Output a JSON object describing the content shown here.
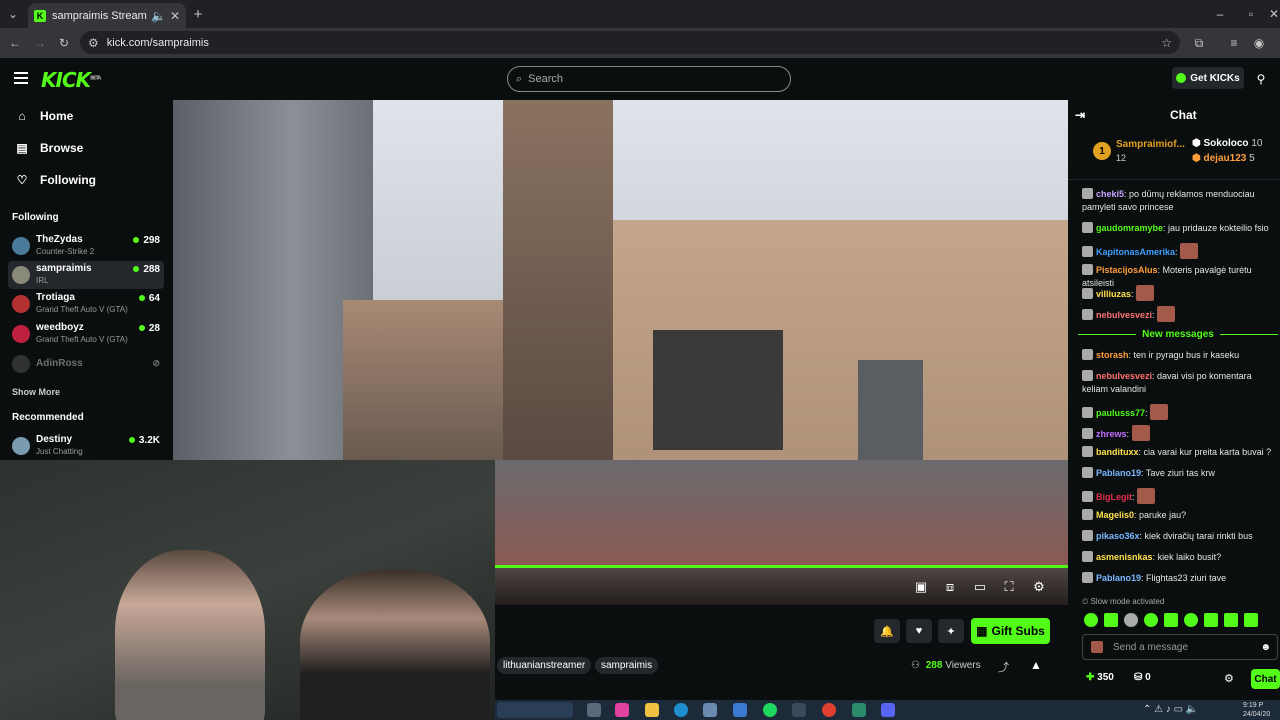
{
  "browser": {
    "tab_title": "sampraimis Stream - Watch",
    "url": "kick.com/sampraimis"
  },
  "header": {
    "logo": "KICK",
    "logo_badge": "BETA",
    "search_placeholder": "Search",
    "get_kicks_label": "Get KICKs"
  },
  "sidebar": {
    "nav": [
      {
        "label": "Home",
        "icon": "home-icon"
      },
      {
        "label": "Browse",
        "icon": "browse-icon"
      },
      {
        "label": "Following",
        "icon": "heart-icon"
      }
    ],
    "following_heading": "Following",
    "following": [
      {
        "name": "TheZydas",
        "game": "Counter-Strike 2",
        "viewers": "298"
      },
      {
        "name": "sampraimis",
        "game": "IRL",
        "viewers": "288"
      },
      {
        "name": "Trotiaga",
        "game": "Grand Theft Auto V (GTA)",
        "viewers": "64"
      },
      {
        "name": "weedboyz",
        "game": "Grand Theft Auto V (GTA)",
        "viewers": "28"
      },
      {
        "name": "AdinRoss",
        "game": "",
        "viewers": ""
      }
    ],
    "show_more": "Show More",
    "recommended_heading": "Recommended",
    "recommended": [
      {
        "name": "Destiny",
        "game": "Just Chatting",
        "viewers": "3.2K"
      }
    ]
  },
  "below_video": {
    "gift_subs_label": "Gift Subs",
    "tags": [
      "lithuanianstreamer",
      "sampraimis"
    ],
    "viewers_count": "288",
    "viewers_label": "Viewers"
  },
  "chat": {
    "title": "Chat",
    "pinned": {
      "rank": "1",
      "top_user": "Sampraimiof...",
      "top_count": "12",
      "user2": "Sokoloco",
      "user2_count": "10",
      "user3": "dejau123",
      "user3_count": "5"
    },
    "messages_before": [
      {
        "user": "cheki5",
        "color": "#c8a2ff",
        "text": "po dūmų reklamos menduociau pamyleti savo princese"
      },
      {
        "user": "gaudomramybe",
        "color": "#53fc18",
        "text": "jau pridauze kokteilio fsio"
      },
      {
        "user": "KapitonasAmerika",
        "color": "#3fa0ff",
        "text": ""
      },
      {
        "user": "PistacijosAlus",
        "color": "#ff9d3c",
        "text": "Moteris pavalgė turėtu atsileisti"
      },
      {
        "user": "villiuzas",
        "color": "#ffe14d",
        "text": ""
      },
      {
        "user": "nebulvesvezi",
        "color": "#ff7070",
        "text": ""
      }
    ],
    "new_messages_label": "New messages",
    "messages_after": [
      {
        "user": "storash",
        "color": "#ff9d3c",
        "text": "ten ir pyragu bus ir kaseku"
      },
      {
        "user": "nebulvesvezi",
        "color": "#ff7070",
        "text": "davai visi po komentara keliam valandini"
      },
      {
        "user": "paulusss77",
        "color": "#53fc18",
        "text": ""
      },
      {
        "user": "zhrews",
        "color": "#c070ff",
        "text": ""
      },
      {
        "user": "bandituxx",
        "color": "#ffe14d",
        "text": "cia varai kur preita karta buvai ?"
      },
      {
        "user": "Pablano19",
        "color": "#7ab8ff",
        "text": "Tave ziuri tas krw"
      },
      {
        "user": "BigLegit",
        "color": "#e0304a",
        "text": ""
      },
      {
        "user": "Magelis0",
        "color": "#ffe14d",
        "text": "paruke jau?"
      },
      {
        "user": "pikaso36x",
        "color": "#7ab8ff",
        "text": "kiek dviračių tarai rinkti bus"
      },
      {
        "user": "asmenisnkas",
        "color": "#ffe14d",
        "text": "kiek laiko busit?"
      },
      {
        "user": "Pablano19",
        "color": "#7ab8ff",
        "text": "Flightas23 ziuri tave"
      }
    ],
    "slow_mode": "Slow mode activated",
    "send_placeholder": "Send a message",
    "kicks_count": "350",
    "gifts_count": "0",
    "chat_button": "Chat"
  },
  "taskbar": {
    "time": "9:19 P",
    "date": "24/04/20"
  }
}
